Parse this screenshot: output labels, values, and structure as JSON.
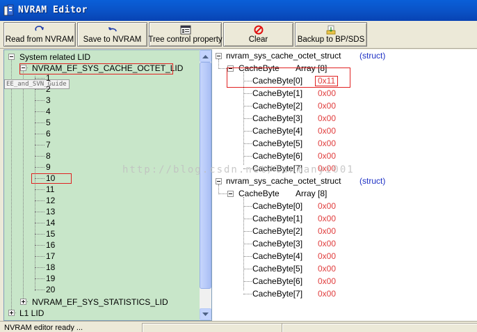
{
  "window": {
    "title": "NVRAM Editor"
  },
  "toolbar": {
    "read_label": "Read from NVRAM",
    "save_label": "Save to NVRAM",
    "tree_label": "Tree control property",
    "clear_label": "Clear",
    "backup_label": "Backup to BP/SDS"
  },
  "tree": {
    "root_label": "System related LID",
    "lid_label": "NVRAM_EF_SYS_CACHE_OCTET_LID",
    "tooltip_fragment": "EE_and_SVN_Guide",
    "items": [
      "1",
      "2",
      "3",
      "4",
      "5",
      "6",
      "7",
      "8",
      "9",
      "10",
      "11",
      "12",
      "13",
      "14",
      "15",
      "16",
      "17",
      "18",
      "19",
      "20"
    ],
    "stats_label": "NVRAM_EF_SYS_STATISTICS_LID",
    "l1_label": "L1 LID"
  },
  "detail": {
    "blocks": [
      {
        "struct_name": "nvram_sys_cache_octet_struct",
        "struct_tag": "(struct)",
        "field": "CacheByte",
        "field_type": "Array [8]",
        "entries": [
          {
            "name": "CacheByte[0]",
            "value": "0x11"
          },
          {
            "name": "CacheByte[1]",
            "value": "0x00"
          },
          {
            "name": "CacheByte[2]",
            "value": "0x00"
          },
          {
            "name": "CacheByte[3]",
            "value": "0x00"
          },
          {
            "name": "CacheByte[4]",
            "value": "0x00"
          },
          {
            "name": "CacheByte[5]",
            "value": "0x00"
          },
          {
            "name": "CacheByte[6]",
            "value": "0x00"
          },
          {
            "name": "CacheByte[7]",
            "value": "0x00"
          }
        ]
      },
      {
        "struct_name": "nvram_sys_cache_octet_struct",
        "struct_tag": "(struct)",
        "field": "CacheByte",
        "field_type": "Array [8]",
        "entries": [
          {
            "name": "CacheByte[0]",
            "value": "0x00"
          },
          {
            "name": "CacheByte[1]",
            "value": "0x00"
          },
          {
            "name": "CacheByte[2]",
            "value": "0x00"
          },
          {
            "name": "CacheByte[3]",
            "value": "0x00"
          },
          {
            "name": "CacheByte[4]",
            "value": "0x00"
          },
          {
            "name": "CacheByte[5]",
            "value": "0x00"
          },
          {
            "name": "CacheByte[6]",
            "value": "0x00"
          },
          {
            "name": "CacheByte[7]",
            "value": "0x00"
          }
        ]
      }
    ]
  },
  "watermark": "http://blog.csdn.net/lanmanyi001",
  "status": {
    "text": "NVRAM editor ready ..."
  },
  "colors": {
    "value_red": "#e03c3c",
    "struct_blue": "#1c2fc4",
    "tree_bg": "#c8e6c9",
    "highlight_box": "#e02020"
  }
}
